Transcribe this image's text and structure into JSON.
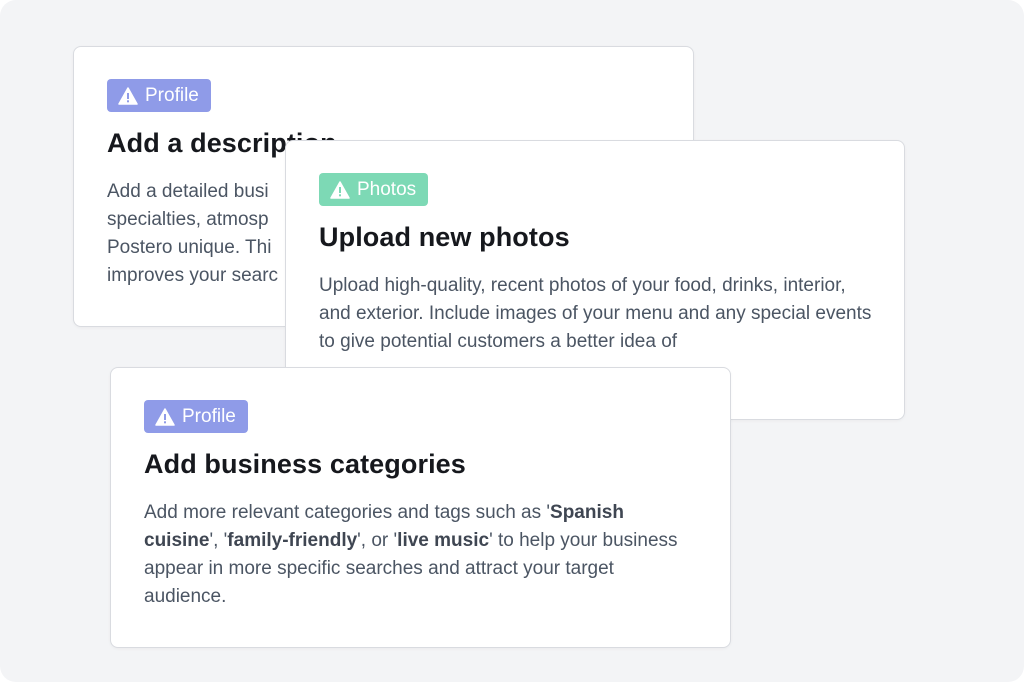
{
  "colors": {
    "profile_badge": "#8f9be8",
    "photos_badge": "#7dd9b5",
    "background": "#f3f4f6"
  },
  "cards": [
    {
      "badge": {
        "label": "Profile",
        "icon": "warning-icon"
      },
      "title": "Add a description",
      "description": "Add a detailed busi specialties, atmosp Postero unique. Thi improves your searc"
    },
    {
      "badge": {
        "label": "Photos",
        "icon": "warning-icon"
      },
      "title": "Upload new photos",
      "description": "Upload high-quality, recent photos of your food, drinks, interior, and exterior. Include images of your menu and any special events to give potential customers a better idea of"
    },
    {
      "badge": {
        "label": "Profile",
        "icon": "warning-icon"
      },
      "title": "Add business categories",
      "description": {
        "t1": "Add more relevant categories and tags such as '",
        "b1": "Spanish cuisine",
        "t2": "', '",
        "b2": "family-friendly",
        "t3": "', or '",
        "b3": "live music",
        "t4": "' to help your business appear in more specific searches and attract your target audience."
      }
    }
  ]
}
